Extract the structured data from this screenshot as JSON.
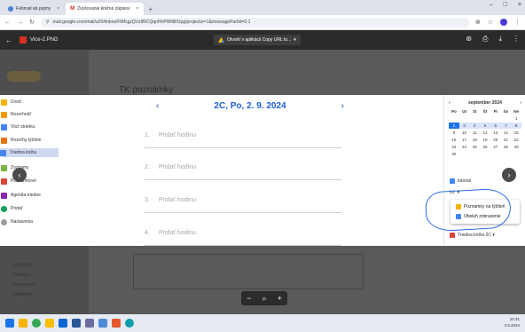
{
  "browser": {
    "tabs": [
      {
        "title": "Fahrrad ab pojmy",
        "active": false
      },
      {
        "title": "Zvyšovanie knižné zápisov",
        "active": true
      }
    ],
    "new_tab": "+",
    "window_controls": {
      "minimize": "–",
      "maximize": "□",
      "close": "×"
    },
    "url": "mail.google.com/mail/u/0/#inbox/FMfcgzQVzIfRCQqnHhPWhB/Upg/projector=1&messagePartId=0.1"
  },
  "drive": {
    "file_name": "Vice-2.PNG",
    "open_with": "Otvoriť v aplikácii Copy URL to...",
    "dropdown": "▾"
  },
  "background_doc": {
    "title": "TK poznámky",
    "folders": [
      "ESRAHO",
      "Tiskoviny",
      "Domácnosť",
      "Odstoupili"
    ]
  },
  "left_panel": {
    "items": [
      {
        "label": "Úvod",
        "color": "#f4b400",
        "selected": false
      },
      {
        "label": "Rozvrhnúť",
        "color": "#f29900",
        "selected": false
      },
      {
        "label": "Vlož stránku",
        "color": "#4285f4",
        "selected": false
      },
      {
        "label": "Rozvrhy týždne",
        "color": "#e8710a",
        "selected": false
      },
      {
        "label": "Triedna kniha",
        "color": "#4285f4",
        "selected": true
      },
      {
        "label": "Zoznamy",
        "color": "#7cb342",
        "selected": false
      },
      {
        "label": "Poznámkové",
        "color": "#db4437",
        "selected": false
      },
      {
        "label": "Agenda triedne",
        "color": "#8e24aa",
        "selected": false
      },
      {
        "label": "Pridať",
        "color": "#0f9d58",
        "selected": false
      },
      {
        "label": "Nastavenia",
        "color": "#9e9e9e",
        "selected": false
      }
    ]
  },
  "main": {
    "date_title": "2C, Po, 2. 9. 2024",
    "prev": "‹",
    "next": "›",
    "hours": [
      {
        "num": "1.",
        "label": "Pridať hodinu"
      },
      {
        "num": "2.",
        "label": "Pridať hodinu"
      },
      {
        "num": "3.",
        "label": "Pridať hodinu"
      },
      {
        "num": "4.",
        "label": "Pridať hodinu"
      }
    ]
  },
  "calendar": {
    "month": "september 2024",
    "prev": "‹",
    "next": "›",
    "dow": [
      "Po",
      "Ut",
      "St",
      "Št",
      "Pi",
      "So",
      "Ne"
    ],
    "days": [
      "",
      "",
      "",
      "",
      "",
      "",
      "1",
      "2",
      "3",
      "4",
      "5",
      "6",
      "7",
      "8",
      "9",
      "10",
      "11",
      "12",
      "13",
      "14",
      "15",
      "16",
      "17",
      "18",
      "19",
      "20",
      "21",
      "22",
      "23",
      "24",
      "25",
      "26",
      "27",
      "28",
      "29",
      "30",
      "",
      "",
      "",
      "",
      "",
      ""
    ],
    "today": "2"
  },
  "right_panel": {
    "tutorial": "tutorial",
    "options": "Ísť",
    "popup_items": [
      "Poznámky na týždeň",
      "Obsluh zobrazenie"
    ],
    "bottom_item": "Triedna kniha 2C ▾",
    "colors": {
      "yellow": "#f4b400",
      "blue": "#4285f4",
      "red": "#db4437",
      "circle": "#2a6de0"
    }
  },
  "preview_nav": {
    "prev": "‹",
    "next": "›"
  },
  "zoom": {
    "minus": "−",
    "zoom_icon": "⌕",
    "plus": "+"
  },
  "taskbar": {
    "time": "10:31",
    "date": "3.9.2024",
    "apps": [
      "windows",
      "search",
      "chrome",
      "files",
      "outlook",
      "word",
      "teams",
      "settings",
      "photos",
      "edge"
    ]
  }
}
